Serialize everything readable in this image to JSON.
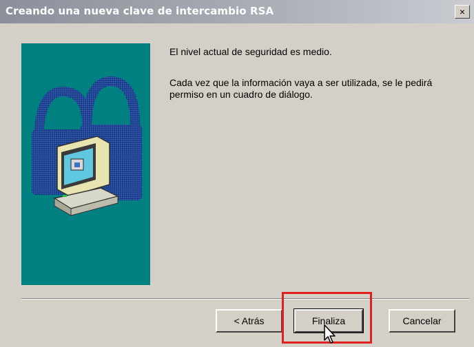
{
  "window": {
    "title": "Creando una nueva clave de intercambio RSA",
    "close_label": "×"
  },
  "content": {
    "message_1": "El nivel actual de seguridad es medio.",
    "message_2": "Cada vez que la información vaya a ser utilizada, se le pedirá permiso en un cuadro de diálogo."
  },
  "buttons": {
    "back": "< Atrás",
    "finish": "Finaliza",
    "cancel": "Cancelar"
  },
  "colors": {
    "panel": "#008080",
    "highlight": "#e0201e"
  },
  "icons": {
    "illustration": "computer-with-padlock-icon",
    "cursor": "mouse-pointer-icon"
  }
}
